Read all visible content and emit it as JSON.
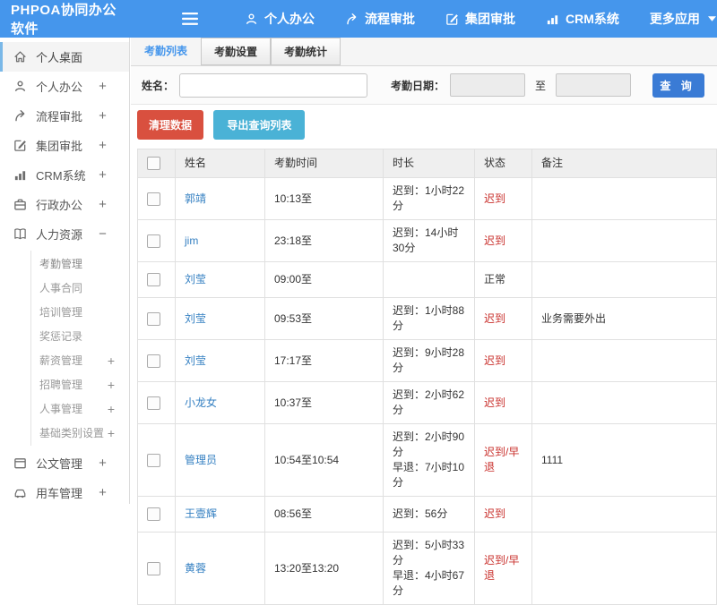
{
  "header": {
    "logo": "PHPOA协同办公软件",
    "menu_icon": "menu-icon",
    "nav": [
      {
        "label": "个人办公",
        "icon": "user-icon"
      },
      {
        "label": "流程审批",
        "icon": "workflow-icon"
      },
      {
        "label": "集团审批",
        "icon": "edit-icon"
      },
      {
        "label": "CRM系统",
        "icon": "chart-icon"
      },
      {
        "label": "更多应用",
        "caret": "caret-down-icon"
      }
    ]
  },
  "sidebar": {
    "items": [
      {
        "label": "个人桌面",
        "icon": "home-icon",
        "active": true
      },
      {
        "label": "个人办公",
        "icon": "user-icon",
        "expand_icon": "plus-icon"
      },
      {
        "label": "流程审批",
        "icon": "workflow-icon",
        "expand_icon": "plus-icon"
      },
      {
        "label": "集团审批",
        "icon": "edit-icon",
        "expand_icon": "plus-icon"
      },
      {
        "label": "CRM系统",
        "icon": "chart-icon",
        "expand_icon": "plus-icon"
      },
      {
        "label": "行政办公",
        "icon": "briefcase-icon",
        "expand_icon": "plus-icon"
      },
      {
        "label": "人力资源",
        "icon": "book-icon",
        "expand_icon": "minus-icon",
        "children": [
          {
            "label": "考勤管理",
            "active": true
          },
          {
            "label": "人事合同"
          },
          {
            "label": "培训管理"
          },
          {
            "label": "奖惩记录"
          },
          {
            "label": "薪资管理",
            "expand_icon": "plus-icon"
          },
          {
            "label": "招聘管理",
            "expand_icon": "plus-icon"
          },
          {
            "label": "人事管理",
            "expand_icon": "plus-icon"
          },
          {
            "label": "基础类别设置",
            "expand_icon": "plus-icon"
          }
        ]
      },
      {
        "label": "公文管理",
        "icon": "doc-icon",
        "expand_icon": "plus-icon"
      },
      {
        "label": "用车管理",
        "icon": "car-icon",
        "expand_icon": "plus-icon"
      }
    ]
  },
  "tabs": [
    {
      "label": "考勤列表",
      "active": true
    },
    {
      "label": "考勤设置",
      "active": false
    },
    {
      "label": "考勤统计",
      "active": false
    }
  ],
  "filter": {
    "name_label": "姓名：",
    "name_value": "",
    "name_placeholder": "",
    "date_label": "考勤日期：",
    "date_from": "",
    "to_label": "至",
    "date_to": "",
    "search_label": "查 询"
  },
  "toolbar": {
    "clean_label": "清理数据",
    "export_label": "导出查询列表"
  },
  "table": {
    "columns": [
      "姓名",
      "考勤时间",
      "时长",
      "状态",
      "备注"
    ],
    "rows": [
      {
        "name": "郭靖",
        "time": "10:13至",
        "duration": [
          "迟到：1小时22分"
        ],
        "status": "迟到",
        "status_type": "late",
        "note": ""
      },
      {
        "name": "jim",
        "time": "23:18至",
        "duration": [
          "迟到：14小时30分"
        ],
        "status": "迟到",
        "status_type": "late",
        "note": ""
      },
      {
        "name": "刘莹",
        "time": "09:00至",
        "duration": [],
        "status": "正常",
        "status_type": "normal",
        "note": ""
      },
      {
        "name": "刘莹",
        "time": "09:53至",
        "duration": [
          "迟到：1小时88分"
        ],
        "status": "迟到",
        "status_type": "late",
        "note": "业务需要外出"
      },
      {
        "name": "刘莹",
        "time": "17:17至",
        "duration": [
          "迟到：9小时28分"
        ],
        "status": "迟到",
        "status_type": "late",
        "note": ""
      },
      {
        "name": "小龙女",
        "time": "10:37至",
        "duration": [
          "迟到：2小时62分"
        ],
        "status": "迟到",
        "status_type": "late",
        "note": ""
      },
      {
        "name": "管理员",
        "time": "10:54至10:54",
        "duration": [
          "迟到：2小时90分",
          "早退：7小时10分"
        ],
        "status": "迟到/早退",
        "status_type": "late",
        "note": "1111"
      },
      {
        "name": "王壹辉",
        "time": "08:56至",
        "duration": [
          "迟到：56分"
        ],
        "status": "迟到",
        "status_type": "late",
        "note": ""
      },
      {
        "name": "黄蓉",
        "time": "13:20至13:20",
        "duration": [
          "迟到：5小时33分",
          "早退：4小时67分"
        ],
        "status": "迟到/早退",
        "status_type": "late",
        "note": ""
      }
    ]
  },
  "colors": {
    "header_bg": "#4596ec",
    "search_button": "#3a7bd5",
    "link_blue": "#3580c2",
    "status_red": "#c9302c",
    "danger_button": "#d9503f",
    "export_button": "#4ab2d6"
  }
}
